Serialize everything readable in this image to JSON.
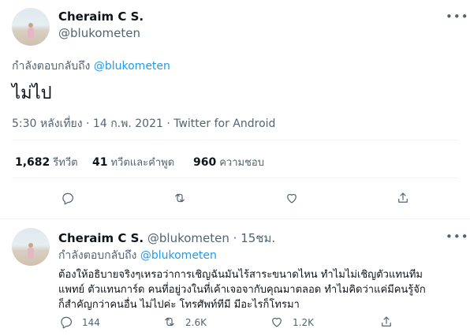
{
  "main_tweet": {
    "display_name": "Cheraim C S.",
    "handle": "@blukometen",
    "replying_prefix": "กำลังตอบกลับถึง",
    "replying_to": "@blukometen",
    "text": "ไม่ไป",
    "timestamp": "5:30 หลังเที่ยง · 14 ก.พ. 2021 · Twitter for Android",
    "stats": [
      {
        "count": "1,682",
        "label": "รีทวีต"
      },
      {
        "count": "41",
        "label": "ทวีตและคำพูด"
      },
      {
        "count": "960",
        "label": "ความชอบ"
      }
    ],
    "more_icon": "more-dots"
  },
  "reply_tweet": {
    "display_name": "Cheraim C S.",
    "handle": "@blukometen",
    "separator": "·",
    "time_ago": "15ชม.",
    "replying_prefix": "กำลังตอบกลับถึง",
    "replying_to": "@blukometen",
    "text_line1": "ต้องให้อธิบายจริงๆเหรอว่าการเชิญฉันมันไร้สาระขนาดไหน ทำไมไม่เชิญตัวแทนทีม",
    "text_line2": "แพทย์ ตัวแทนการ์ด คนที่อยู่วงในที่เค้าเจอจากับคุณมาตลอด ทำไมคิดว่าแค่มีคนรู้จัก",
    "text_line3": "ก็สำคัญกว่าคนอื่น ไม่ไปค่ะ โทรศัพท์ทีมี มีอะไรก็โทรมา",
    "actions": {
      "reply_count": "144",
      "retweet_count": "2.6K",
      "like_count": "1.2K"
    }
  }
}
